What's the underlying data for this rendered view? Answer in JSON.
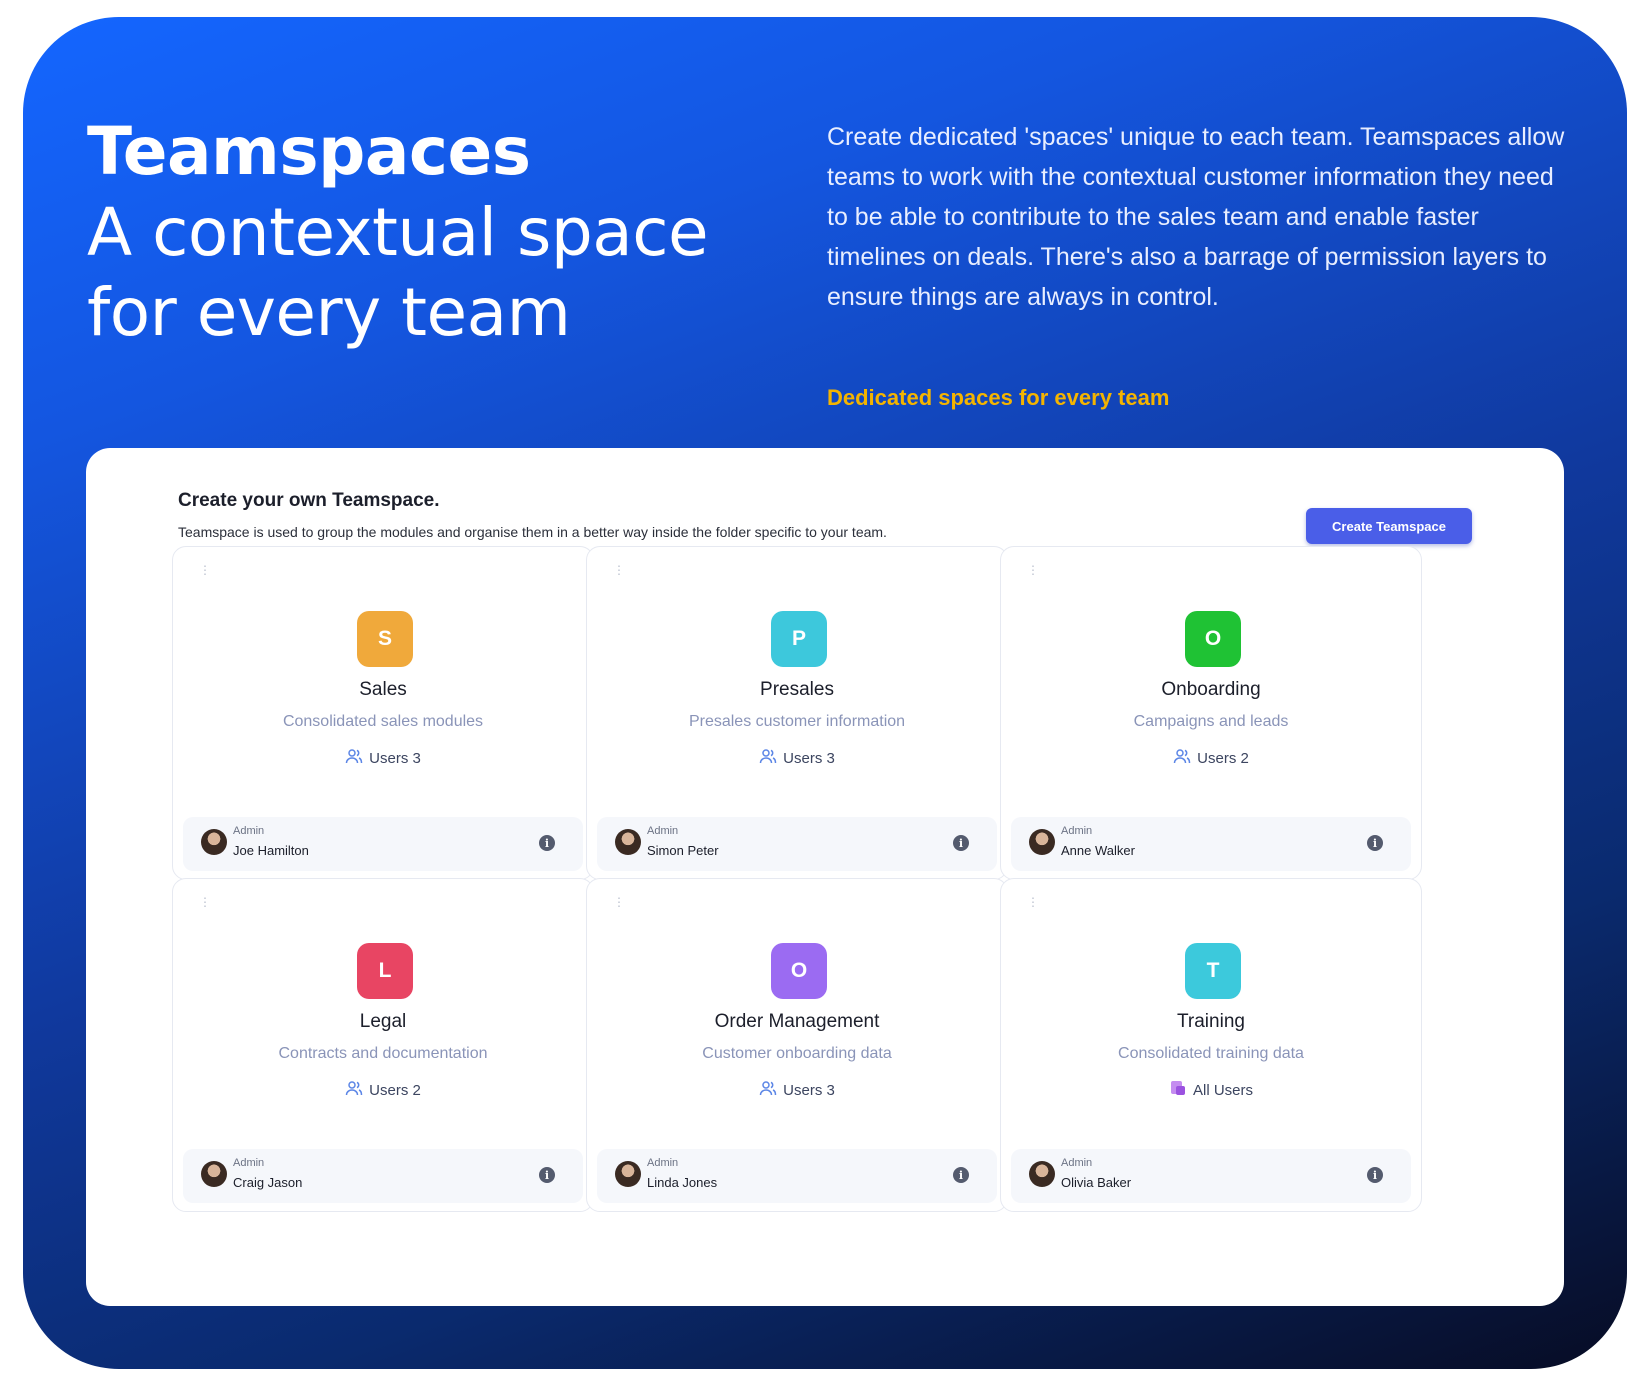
{
  "hero": {
    "title_bold": "Teamspaces",
    "title_light": "A contextual space for every team",
    "description": "Create dedicated 'spaces' unique to each team. Teamspaces allow teams to work with the contextual customer information they need to be able to contribute to the sales team and enable faster timelines on deals. There's also a barrage of permission layers to ensure things are always in control.",
    "tagline": "Dedicated spaces for every team"
  },
  "panel": {
    "title": "Create your own Teamspace.",
    "subtitle": "Teamspace is used to group the modules and organise them in a better way inside the folder specific to your team.",
    "create_button": "Create Teamspace"
  },
  "cards": [
    {
      "initial": "S",
      "color": "#f0a93b",
      "name": "Sales",
      "desc": "Consolidated sales modules",
      "users": "Users 3",
      "users_icon": "users-icon",
      "admin_label": "Admin",
      "admin": "Joe Hamilton"
    },
    {
      "initial": "P",
      "color": "#3dc8dc",
      "name": "Presales",
      "desc": "Presales customer information",
      "users": "Users 3",
      "users_icon": "users-icon",
      "admin_label": "Admin",
      "admin": "Simon Peter"
    },
    {
      "initial": "O",
      "color": "#1fc234",
      "name": "Onboarding",
      "desc": "Campaigns and leads",
      "users": "Users 2",
      "users_icon": "users-icon",
      "admin_label": "Admin",
      "admin": "Anne Walker"
    },
    {
      "initial": "L",
      "color": "#e84563",
      "name": "Legal",
      "desc": "Contracts and documentation",
      "users": "Users 2",
      "users_icon": "users-icon",
      "admin_label": "Admin",
      "admin": "Craig Jason"
    },
    {
      "initial": "O",
      "color": "#9b6bf2",
      "name": "Order Management",
      "desc": "Customer onboarding data",
      "users": "Users 3",
      "users_icon": "users-icon",
      "admin_label": "Admin",
      "admin": "Linda Jones"
    },
    {
      "initial": "T",
      "color": "#3cc9dc",
      "name": "Training",
      "desc": "Consolidated training data",
      "users": "All Users",
      "users_icon": "all-users-icon",
      "admin_label": "Admin",
      "admin": "Olivia Baker"
    }
  ]
}
